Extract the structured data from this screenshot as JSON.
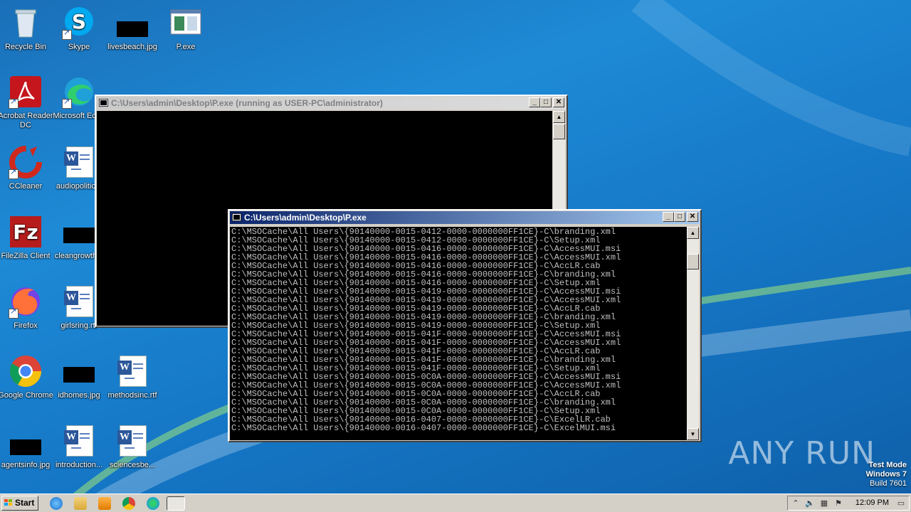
{
  "desktop": {
    "icons": [
      {
        "label": "Recycle Bin",
        "icon": "recycle-bin-icon"
      },
      {
        "label": "Skype",
        "icon": "skype-icon"
      },
      {
        "label": "livesbeach.jpg",
        "icon": "image-file-icon"
      },
      {
        "label": "P.exe",
        "icon": "exe-file-icon"
      },
      {
        "label": "Acrobat Reader DC",
        "icon": "acrobat-icon"
      },
      {
        "label": "Microsoft Edge",
        "icon": "edge-icon"
      },
      {
        "label": "CCleaner",
        "icon": "ccleaner-icon"
      },
      {
        "label": "audiopolitic...",
        "icon": "word-document-icon"
      },
      {
        "label": "FileZilla Client",
        "icon": "filezilla-icon"
      },
      {
        "label": "cleangrowth...",
        "icon": "image-file-icon"
      },
      {
        "label": "Firefox",
        "icon": "firefox-icon"
      },
      {
        "label": "girlsring.rtf",
        "icon": "word-document-icon"
      },
      {
        "label": "Google Chrome",
        "icon": "chrome-icon"
      },
      {
        "label": "idhomes.jpg",
        "icon": "image-file-icon"
      },
      {
        "label": "methodsinc.rtf",
        "icon": "word-document-icon"
      },
      {
        "label": "agentsinfo.jpg",
        "icon": "image-file-icon"
      },
      {
        "label": "introduction...",
        "icon": "word-document-icon"
      },
      {
        "label": "sciencesbe...",
        "icon": "word-document-icon"
      }
    ]
  },
  "windows": {
    "back": {
      "title": "C:\\Users\\admin\\Desktop\\P.exe (running as USER-PC\\administrator)"
    },
    "front": {
      "title": "C:\\Users\\admin\\Desktop\\P.exe",
      "lines": [
        "C:\\MSOCache\\All Users\\{90140000-0015-0412-0000-0000000FF1CE}-C\\branding.xml",
        "C:\\MSOCache\\All Users\\{90140000-0015-0412-0000-0000000FF1CE}-C\\Setup.xml",
        "C:\\MSOCache\\All Users\\{90140000-0015-0416-0000-0000000FF1CE}-C\\AccessMUI.msi",
        "C:\\MSOCache\\All Users\\{90140000-0015-0416-0000-0000000FF1CE}-C\\AccessMUI.xml",
        "C:\\MSOCache\\All Users\\{90140000-0015-0416-0000-0000000FF1CE}-C\\AccLR.cab",
        "C:\\MSOCache\\All Users\\{90140000-0015-0416-0000-0000000FF1CE}-C\\branding.xml",
        "C:\\MSOCache\\All Users\\{90140000-0015-0416-0000-0000000FF1CE}-C\\Setup.xml",
        "C:\\MSOCache\\All Users\\{90140000-0015-0419-0000-0000000FF1CE}-C\\AccessMUI.msi",
        "C:\\MSOCache\\All Users\\{90140000-0015-0419-0000-0000000FF1CE}-C\\AccessMUI.xml",
        "C:\\MSOCache\\All Users\\{90140000-0015-0419-0000-0000000FF1CE}-C\\AccLR.cab",
        "C:\\MSOCache\\All Users\\{90140000-0015-0419-0000-0000000FF1CE}-C\\branding.xml",
        "C:\\MSOCache\\All Users\\{90140000-0015-0419-0000-0000000FF1CE}-C\\Setup.xml",
        "C:\\MSOCache\\All Users\\{90140000-0015-041F-0000-0000000FF1CE}-C\\AccessMUI.msi",
        "C:\\MSOCache\\All Users\\{90140000-0015-041F-0000-0000000FF1CE}-C\\AccessMUI.xml",
        "C:\\MSOCache\\All Users\\{90140000-0015-041F-0000-0000000FF1CE}-C\\AccLR.cab",
        "C:\\MSOCache\\All Users\\{90140000-0015-041F-0000-0000000FF1CE}-C\\branding.xml",
        "C:\\MSOCache\\All Users\\{90140000-0015-041F-0000-0000000FF1CE}-C\\Setup.xml",
        "C:\\MSOCache\\All Users\\{90140000-0015-0C0A-0000-0000000FF1CE}-C\\AccessMUI.msi",
        "C:\\MSOCache\\All Users\\{90140000-0015-0C0A-0000-0000000FF1CE}-C\\AccessMUI.xml",
        "C:\\MSOCache\\All Users\\{90140000-0015-0C0A-0000-0000000FF1CE}-C\\AccLR.cab",
        "C:\\MSOCache\\All Users\\{90140000-0015-0C0A-0000-0000000FF1CE}-C\\branding.xml",
        "C:\\MSOCache\\All Users\\{90140000-0015-0C0A-0000-0000000FF1CE}-C\\Setup.xml",
        "C:\\MSOCache\\All Users\\{90140000-0016-0407-0000-0000000FF1CE}-C\\ExcelLR.cab",
        "C:\\MSOCache\\All Users\\{90140000-0016-0407-0000-0000000FF1CE}-C\\ExcelMUI.msi"
      ]
    }
  },
  "taskbar": {
    "start_label": "Start",
    "clock": "12:09 PM"
  },
  "watermark": {
    "brand": "ANY RUN",
    "test_mode": "Test Mode",
    "os": "Windows 7",
    "build": "Build 7601"
  },
  "colors": {
    "desktop_bg": "#1e8ad6",
    "active_title_start": "#0a246a",
    "active_title_end": "#a6caf0",
    "console_bg": "#000000",
    "console_fg": "#c0c0c0"
  }
}
